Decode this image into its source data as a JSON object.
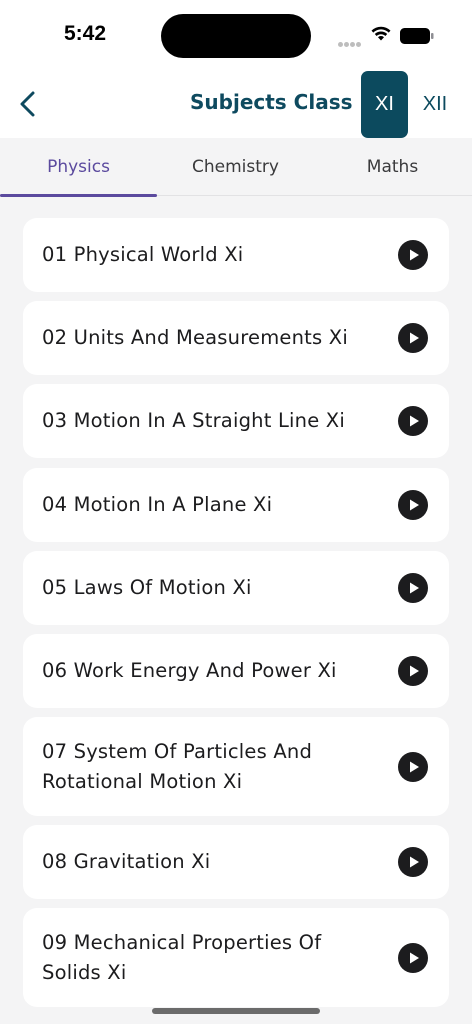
{
  "status_bar": {
    "time": "5:42"
  },
  "header": {
    "title": "Subjects Class",
    "class_options": [
      "XI",
      "XII"
    ],
    "selected_class": "XI",
    "accent_color": "#0c4a5e"
  },
  "tabs": [
    {
      "label": "Physics",
      "active": true
    },
    {
      "label": "Chemistry",
      "active": false
    },
    {
      "label": "Maths",
      "active": false
    }
  ],
  "tab_accent_color": "#5b4a9e",
  "chapters": [
    {
      "title": "01 Physical World Xi",
      "icon": "play-circle-icon"
    },
    {
      "title": "02 Units And Measurements Xi",
      "icon": "play-circle-icon"
    },
    {
      "title": "03 Motion In A Straight Line Xi",
      "icon": "play-circle-icon"
    },
    {
      "title": "04 Motion In A Plane Xi",
      "icon": "play-circle-icon"
    },
    {
      "title": "05 Laws Of Motion Xi",
      "icon": "play-circle-icon"
    },
    {
      "title": "06 Work Energy And Power Xi",
      "icon": "play-circle-icon"
    },
    {
      "title": "07 System Of Particles And Rotational Motion Xi",
      "icon": "play-circle-icon"
    },
    {
      "title": "08 Gravitation Xi",
      "icon": "play-circle-icon"
    },
    {
      "title": "09 Mechanical Properties Of Solids Xi",
      "icon": "play-circle-icon"
    }
  ]
}
